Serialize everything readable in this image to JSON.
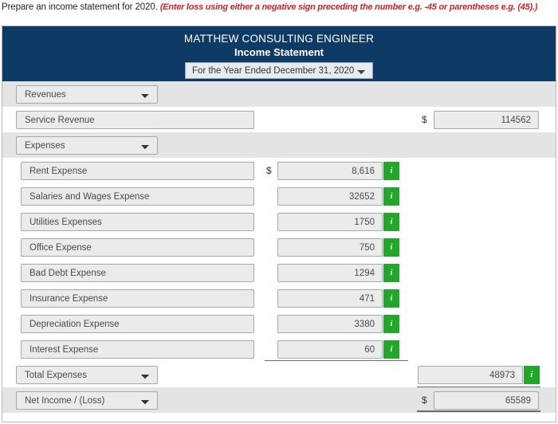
{
  "instruction": {
    "main": "Prepare an income statement for 2020. ",
    "hint": "(Enter loss using either a negative sign preceding the number e.g. -45 or parentheses e.g. (45).)"
  },
  "header": {
    "company": "MATTHEW CONSULTING ENGINEER",
    "statement_title": "Income Statement",
    "period_selected": "For the Year Ended December 31, 2020",
    "band_color": "#0e3a66"
  },
  "icons": {
    "info": "i",
    "info_color": "#22a72a"
  },
  "symbols": {
    "dollar": "$"
  },
  "rows": {
    "revenues_category": "Revenues",
    "service_revenue_label": "Service Revenue",
    "service_revenue_value": "114562",
    "expenses_category": "Expenses",
    "total_expenses_category": "Total Expenses",
    "total_expenses_value": "48973",
    "net_income_category": "Net Income / (Loss)",
    "net_income_value": "65589"
  },
  "expenses": [
    {
      "label": "Rent Expense",
      "value": "8,616"
    },
    {
      "label": "Salaries and Wages Expense",
      "value": "32652"
    },
    {
      "label": "Utilities Expenses",
      "value": "1750"
    },
    {
      "label": "Office Expense",
      "value": "750"
    },
    {
      "label": "Bad Debt Expense",
      "value": "1294"
    },
    {
      "label": "Insurance Expense",
      "value": "471"
    },
    {
      "label": "Depreciation Expense",
      "value": "3380"
    },
    {
      "label": "Interest Expense",
      "value": "60"
    }
  ]
}
